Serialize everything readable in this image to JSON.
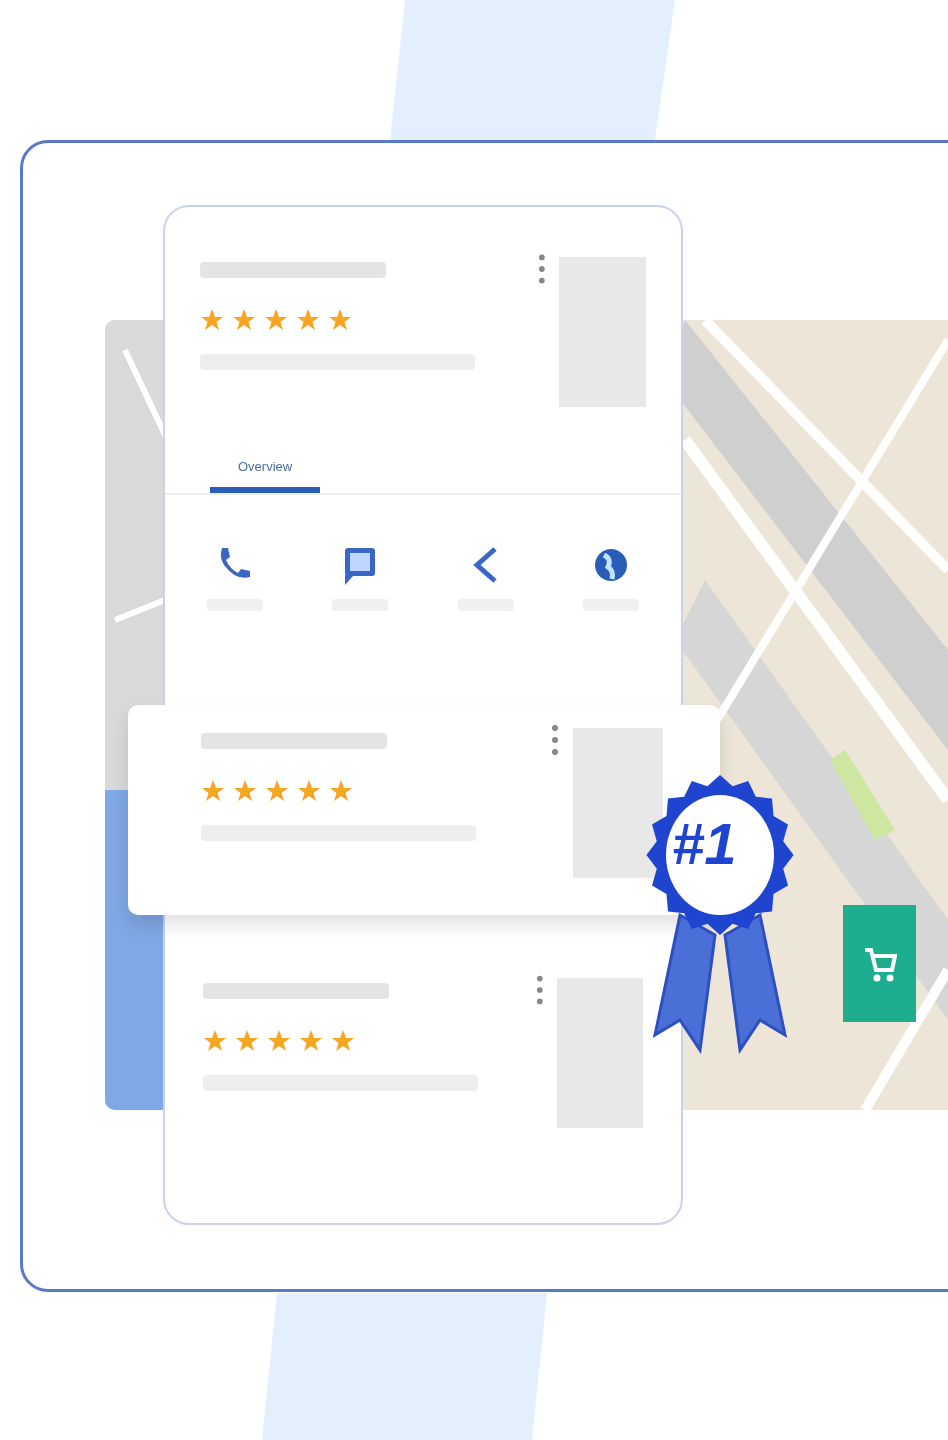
{
  "listings": [
    {
      "stars": 5
    },
    {
      "stars": 5
    },
    {
      "stars": 5
    }
  ],
  "tabs": [
    {
      "label": "Overview",
      "selected": true
    }
  ],
  "actions": [
    {
      "kind": "phone"
    },
    {
      "kind": "message"
    },
    {
      "kind": "share"
    },
    {
      "kind": "globe"
    }
  ],
  "badge": {
    "label": "#1"
  }
}
